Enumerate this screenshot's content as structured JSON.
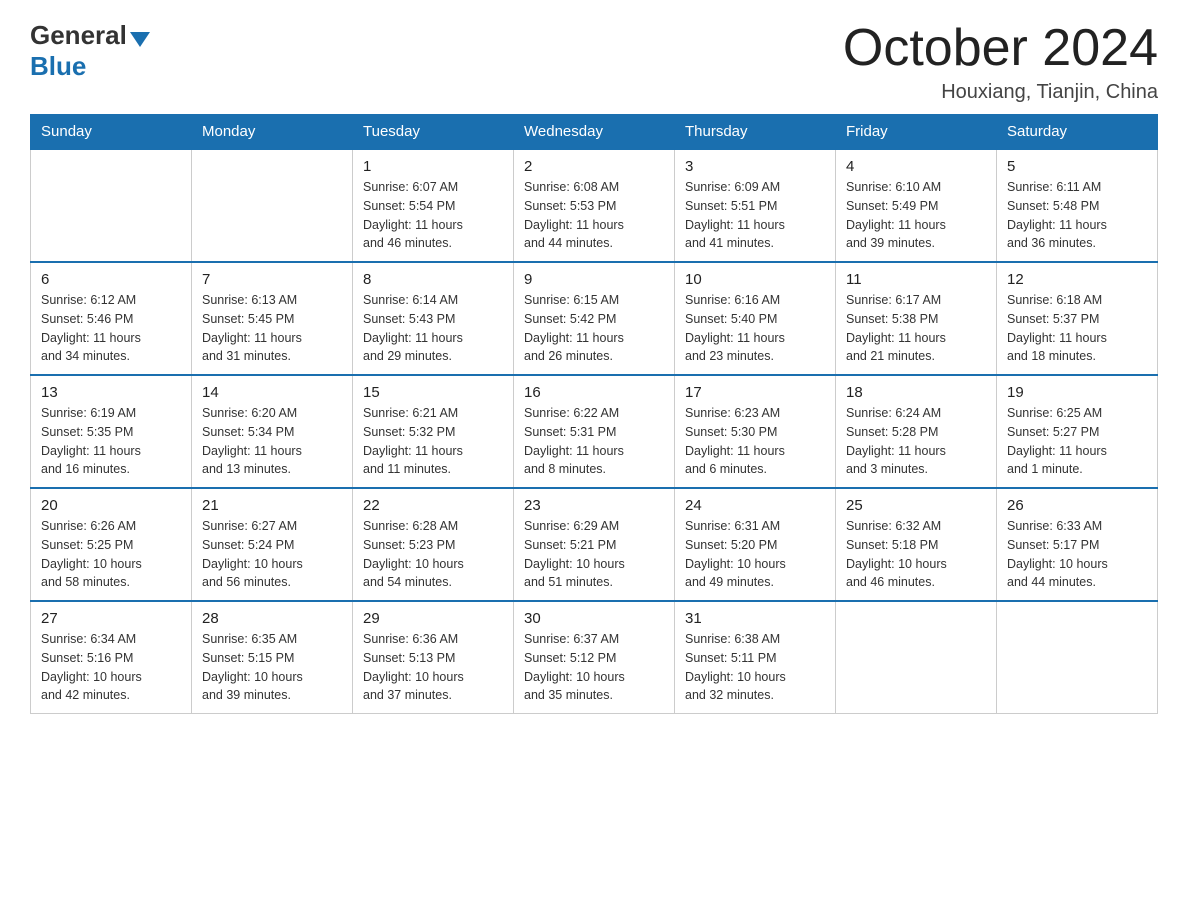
{
  "logo": {
    "general": "General",
    "blue": "Blue"
  },
  "title": "October 2024",
  "location": "Houxiang, Tianjin, China",
  "days_of_week": [
    "Sunday",
    "Monday",
    "Tuesday",
    "Wednesday",
    "Thursday",
    "Friday",
    "Saturday"
  ],
  "weeks": [
    [
      {
        "day": "",
        "info": ""
      },
      {
        "day": "",
        "info": ""
      },
      {
        "day": "1",
        "info": "Sunrise: 6:07 AM\nSunset: 5:54 PM\nDaylight: 11 hours\nand 46 minutes."
      },
      {
        "day": "2",
        "info": "Sunrise: 6:08 AM\nSunset: 5:53 PM\nDaylight: 11 hours\nand 44 minutes."
      },
      {
        "day": "3",
        "info": "Sunrise: 6:09 AM\nSunset: 5:51 PM\nDaylight: 11 hours\nand 41 minutes."
      },
      {
        "day": "4",
        "info": "Sunrise: 6:10 AM\nSunset: 5:49 PM\nDaylight: 11 hours\nand 39 minutes."
      },
      {
        "day": "5",
        "info": "Sunrise: 6:11 AM\nSunset: 5:48 PM\nDaylight: 11 hours\nand 36 minutes."
      }
    ],
    [
      {
        "day": "6",
        "info": "Sunrise: 6:12 AM\nSunset: 5:46 PM\nDaylight: 11 hours\nand 34 minutes."
      },
      {
        "day": "7",
        "info": "Sunrise: 6:13 AM\nSunset: 5:45 PM\nDaylight: 11 hours\nand 31 minutes."
      },
      {
        "day": "8",
        "info": "Sunrise: 6:14 AM\nSunset: 5:43 PM\nDaylight: 11 hours\nand 29 minutes."
      },
      {
        "day": "9",
        "info": "Sunrise: 6:15 AM\nSunset: 5:42 PM\nDaylight: 11 hours\nand 26 minutes."
      },
      {
        "day": "10",
        "info": "Sunrise: 6:16 AM\nSunset: 5:40 PM\nDaylight: 11 hours\nand 23 minutes."
      },
      {
        "day": "11",
        "info": "Sunrise: 6:17 AM\nSunset: 5:38 PM\nDaylight: 11 hours\nand 21 minutes."
      },
      {
        "day": "12",
        "info": "Sunrise: 6:18 AM\nSunset: 5:37 PM\nDaylight: 11 hours\nand 18 minutes."
      }
    ],
    [
      {
        "day": "13",
        "info": "Sunrise: 6:19 AM\nSunset: 5:35 PM\nDaylight: 11 hours\nand 16 minutes."
      },
      {
        "day": "14",
        "info": "Sunrise: 6:20 AM\nSunset: 5:34 PM\nDaylight: 11 hours\nand 13 minutes."
      },
      {
        "day": "15",
        "info": "Sunrise: 6:21 AM\nSunset: 5:32 PM\nDaylight: 11 hours\nand 11 minutes."
      },
      {
        "day": "16",
        "info": "Sunrise: 6:22 AM\nSunset: 5:31 PM\nDaylight: 11 hours\nand 8 minutes."
      },
      {
        "day": "17",
        "info": "Sunrise: 6:23 AM\nSunset: 5:30 PM\nDaylight: 11 hours\nand 6 minutes."
      },
      {
        "day": "18",
        "info": "Sunrise: 6:24 AM\nSunset: 5:28 PM\nDaylight: 11 hours\nand 3 minutes."
      },
      {
        "day": "19",
        "info": "Sunrise: 6:25 AM\nSunset: 5:27 PM\nDaylight: 11 hours\nand 1 minute."
      }
    ],
    [
      {
        "day": "20",
        "info": "Sunrise: 6:26 AM\nSunset: 5:25 PM\nDaylight: 10 hours\nand 58 minutes."
      },
      {
        "day": "21",
        "info": "Sunrise: 6:27 AM\nSunset: 5:24 PM\nDaylight: 10 hours\nand 56 minutes."
      },
      {
        "day": "22",
        "info": "Sunrise: 6:28 AM\nSunset: 5:23 PM\nDaylight: 10 hours\nand 54 minutes."
      },
      {
        "day": "23",
        "info": "Sunrise: 6:29 AM\nSunset: 5:21 PM\nDaylight: 10 hours\nand 51 minutes."
      },
      {
        "day": "24",
        "info": "Sunrise: 6:31 AM\nSunset: 5:20 PM\nDaylight: 10 hours\nand 49 minutes."
      },
      {
        "day": "25",
        "info": "Sunrise: 6:32 AM\nSunset: 5:18 PM\nDaylight: 10 hours\nand 46 minutes."
      },
      {
        "day": "26",
        "info": "Sunrise: 6:33 AM\nSunset: 5:17 PM\nDaylight: 10 hours\nand 44 minutes."
      }
    ],
    [
      {
        "day": "27",
        "info": "Sunrise: 6:34 AM\nSunset: 5:16 PM\nDaylight: 10 hours\nand 42 minutes."
      },
      {
        "day": "28",
        "info": "Sunrise: 6:35 AM\nSunset: 5:15 PM\nDaylight: 10 hours\nand 39 minutes."
      },
      {
        "day": "29",
        "info": "Sunrise: 6:36 AM\nSunset: 5:13 PM\nDaylight: 10 hours\nand 37 minutes."
      },
      {
        "day": "30",
        "info": "Sunrise: 6:37 AM\nSunset: 5:12 PM\nDaylight: 10 hours\nand 35 minutes."
      },
      {
        "day": "31",
        "info": "Sunrise: 6:38 AM\nSunset: 5:11 PM\nDaylight: 10 hours\nand 32 minutes."
      },
      {
        "day": "",
        "info": ""
      },
      {
        "day": "",
        "info": ""
      }
    ]
  ]
}
